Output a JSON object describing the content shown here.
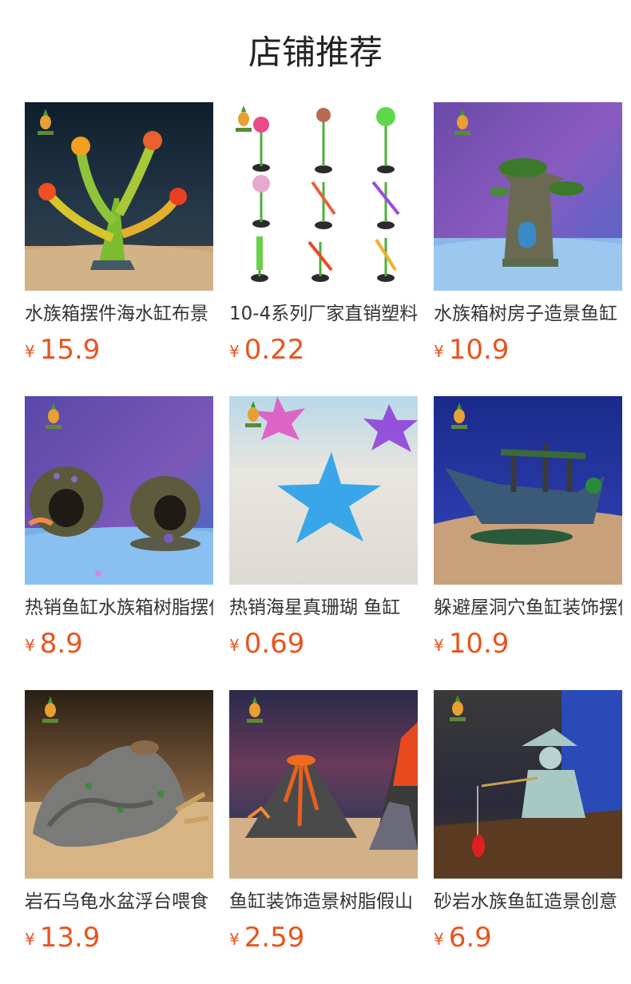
{
  "section_title": "店铺推荐",
  "currency_symbol": "¥",
  "price_color": "#e8541e",
  "products": [
    {
      "name": "水族箱摆件海水缸布景",
      "price": "15.9",
      "image_icon": "coral-ornament"
    },
    {
      "name": "10-4系列厂家直销塑料",
      "price": "0.22",
      "image_icon": "plastic-plants-set"
    },
    {
      "name": "水族箱树房子造景鱼缸",
      "price": "10.9",
      "image_icon": "tree-house"
    },
    {
      "name": "热销鱼缸水族箱树脂摆件",
      "price": "8.9",
      "image_icon": "barrel-caves"
    },
    {
      "name": "热销海星真珊瑚 鱼缸",
      "price": "0.69",
      "image_icon": "starfish"
    },
    {
      "name": "躲避屋洞穴鱼缸装饰摆件",
      "price": "10.9",
      "image_icon": "shipwreck"
    },
    {
      "name": "岩石乌龟水盆浮台喂食",
      "price": "13.9",
      "image_icon": "turtle-rock"
    },
    {
      "name": "鱼缸装饰造景树脂假山",
      "price": "2.59",
      "image_icon": "volcano"
    },
    {
      "name": "砂岩水族鱼缸造景创意",
      "price": "6.9",
      "image_icon": "fisherman-figurine"
    }
  ]
}
